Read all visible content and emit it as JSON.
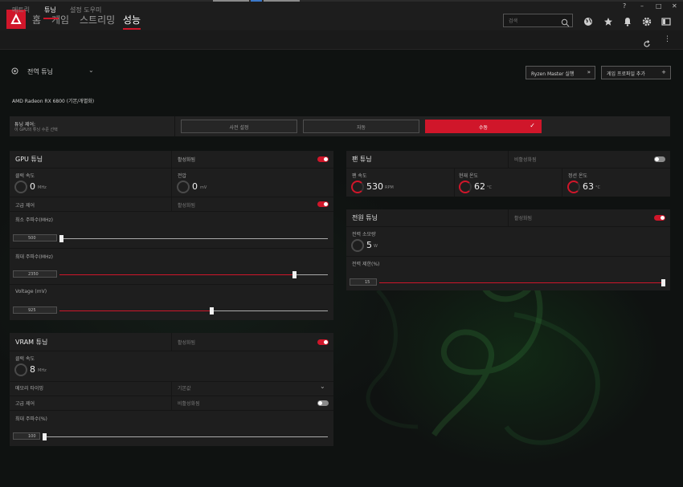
{
  "nav": {
    "tabs": [
      "홈",
      "게임",
      "스트리밍",
      "성능"
    ],
    "active_tab": "성능",
    "search_placeholder": "검색",
    "window_controls": [
      "?",
      "–",
      "□",
      "✕"
    ]
  },
  "subnav": {
    "tabs": [
      "메트릭",
      "튜닝",
      "설정 도우미"
    ],
    "active_tab": "튜닝"
  },
  "header": {
    "tuning_selector": "전역 튜닝",
    "ryzen_master_button": "Ryzen Master 실행",
    "game_profile_button": "게임 프로파일 추가",
    "gpu_name": "AMD Radeon RX 6800 (기본/개별화)"
  },
  "tuning_control": {
    "title": "튜닝 제어:",
    "subtitle": "이 GPU의 튜닝 수준 선택",
    "options": [
      "사전 설정",
      "자동",
      "수동"
    ],
    "selected": "수동"
  },
  "gpu_tuning": {
    "title": "GPU 튜닝",
    "status": "활성화됨",
    "enabled": true,
    "clock_label": "클럭 속도",
    "clock_value": "0",
    "clock_unit": "MHz",
    "voltage_label": "전압",
    "voltage_value": "0",
    "voltage_unit": "mV",
    "advanced_label": "고급 제어",
    "advanced_status": "활성화됨",
    "advanced_enabled": true,
    "min_freq_label": "최소 주파수(MHz)",
    "min_freq_value": "500",
    "min_freq_fraction": 0.0,
    "max_freq_label": "최대 주파수(MHz)",
    "max_freq_value": "2350",
    "max_freq_fraction": 0.88,
    "voltage_mv_label": "Voltage (mV)",
    "voltage_mv_value": "925",
    "voltage_mv_fraction": 0.56
  },
  "fan_tuning": {
    "title": "팬 튜닝",
    "status": "비활성화됨",
    "enabled": false,
    "fan_speed_label": "팬 속도",
    "fan_speed_value": "530",
    "fan_speed_unit": "RPM",
    "current_temp_label": "현재 온도",
    "current_temp_value": "62",
    "current_temp_unit": "°C",
    "junction_temp_label": "정션 온도",
    "junction_temp_value": "63",
    "junction_temp_unit": "°C"
  },
  "power_tuning": {
    "title": "전원 튜닝",
    "status": "활성화됨",
    "enabled": true,
    "power_label": "전력 소모량",
    "power_value": "5",
    "power_unit": "W",
    "limit_label": "전력 제한(%)",
    "limit_value": "15",
    "limit_fraction": 1.0
  },
  "vram_tuning": {
    "title": "VRAM 튜닝",
    "status": "활성화됨",
    "enabled": true,
    "clock_label": "클럭 속도",
    "clock_value": "8",
    "clock_unit": "MHz",
    "timing_label": "메모리 타이밍",
    "timing_value": "기본값",
    "advanced_label": "고급 제어",
    "advanced_status": "비활성화됨",
    "advanced_enabled": false,
    "max_freq_label": "최대 주파수(%)",
    "max_freq_value": "100",
    "max_freq_fraction": 0.0
  },
  "colors": {
    "accent": "#d0162a",
    "panel": "#1e1e1e",
    "background": "#0f1211"
  }
}
